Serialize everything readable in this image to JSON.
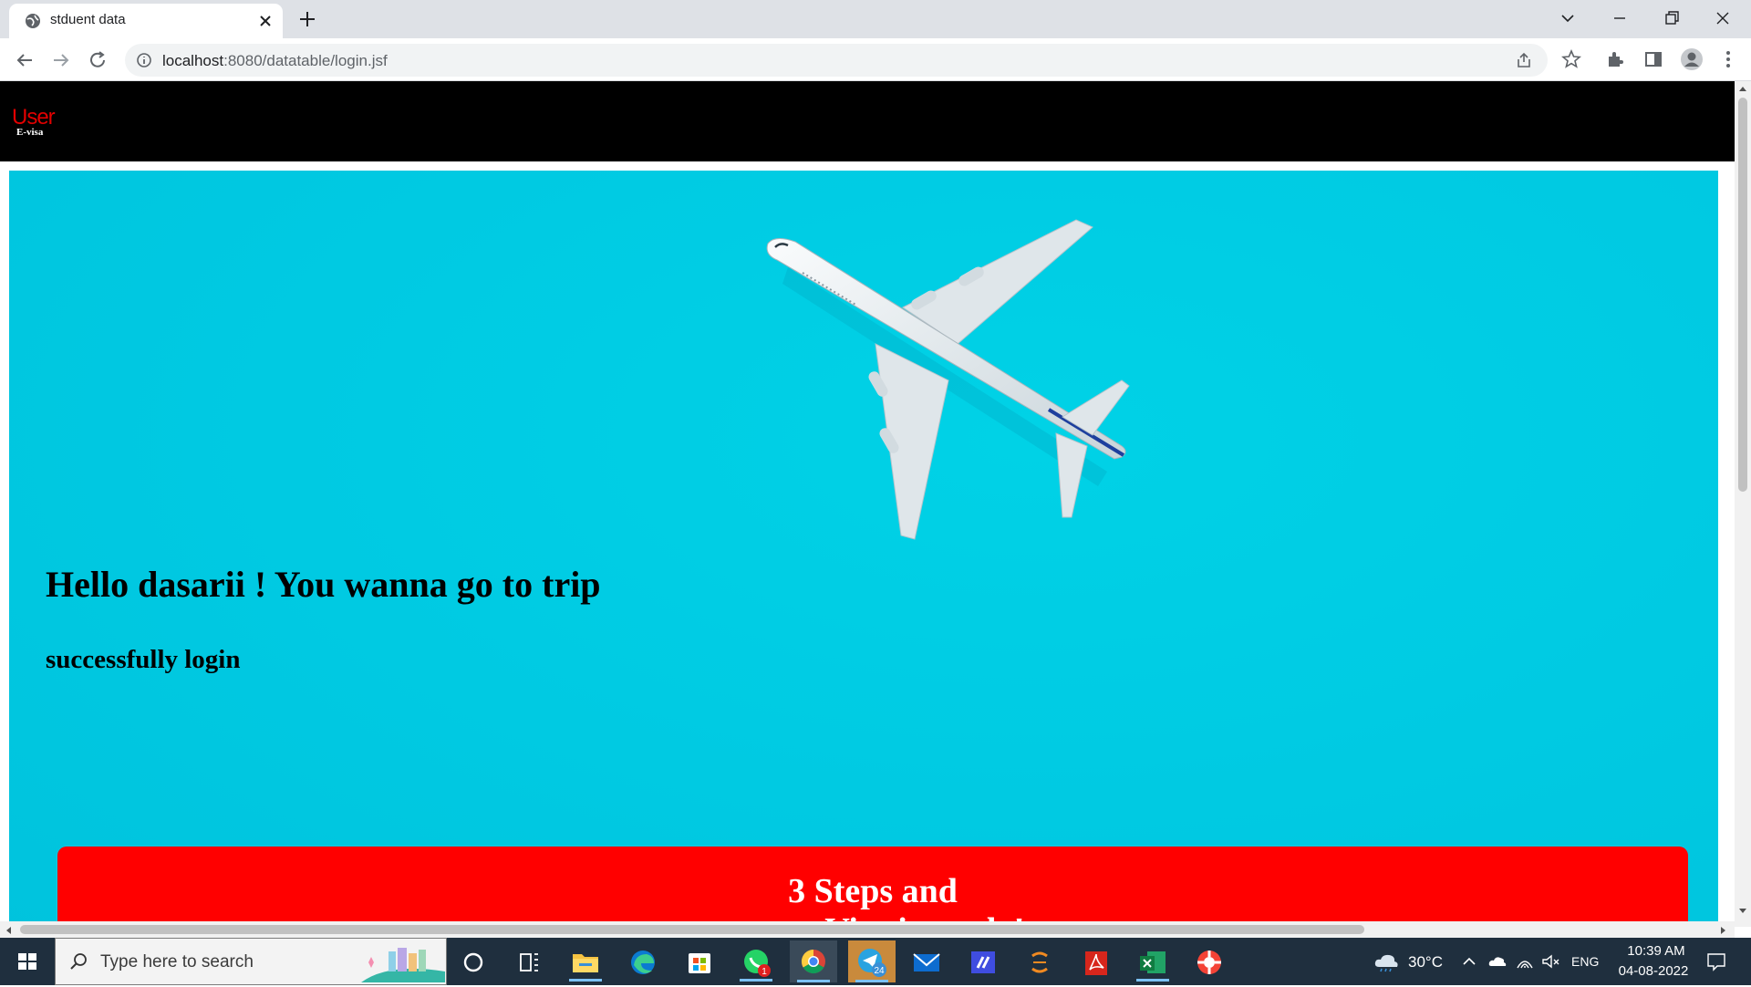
{
  "browser": {
    "tab_title": "stduent data",
    "url_host": "localhost",
    "url_path": ":8080/datatable/login.jsf"
  },
  "site": {
    "logo_main": "User",
    "logo_sub": "E-visa",
    "greeting": "Hello dasarii ! You wanna go to trip",
    "login_message": "successfully login",
    "steps_line1": "3 Steps and",
    "steps_line2": "your e-Visa is ready!",
    "colors": {
      "header_bg": "#000000",
      "hero_bg": "#00cbe3",
      "steps_bg": "#ff0000",
      "logo_red": "#e20000"
    }
  },
  "taskbar": {
    "search_placeholder": "Type here to search",
    "temperature": "30°C",
    "language": "ENG",
    "time": "10:39 AM",
    "date": "04-08-2022",
    "whatsapp_badge": "1",
    "telegram_badge": "24",
    "apps": [
      "cortana-icon",
      "task-view-icon",
      "file-explorer-icon",
      "edge-icon",
      "store-icon",
      "whatsapp-icon",
      "chrome-icon",
      "telegram-icon",
      "mail-icon",
      "vscode-like-icon",
      "eclipse-icon",
      "acrobat-icon",
      "excel-icon",
      "help-icon"
    ]
  }
}
